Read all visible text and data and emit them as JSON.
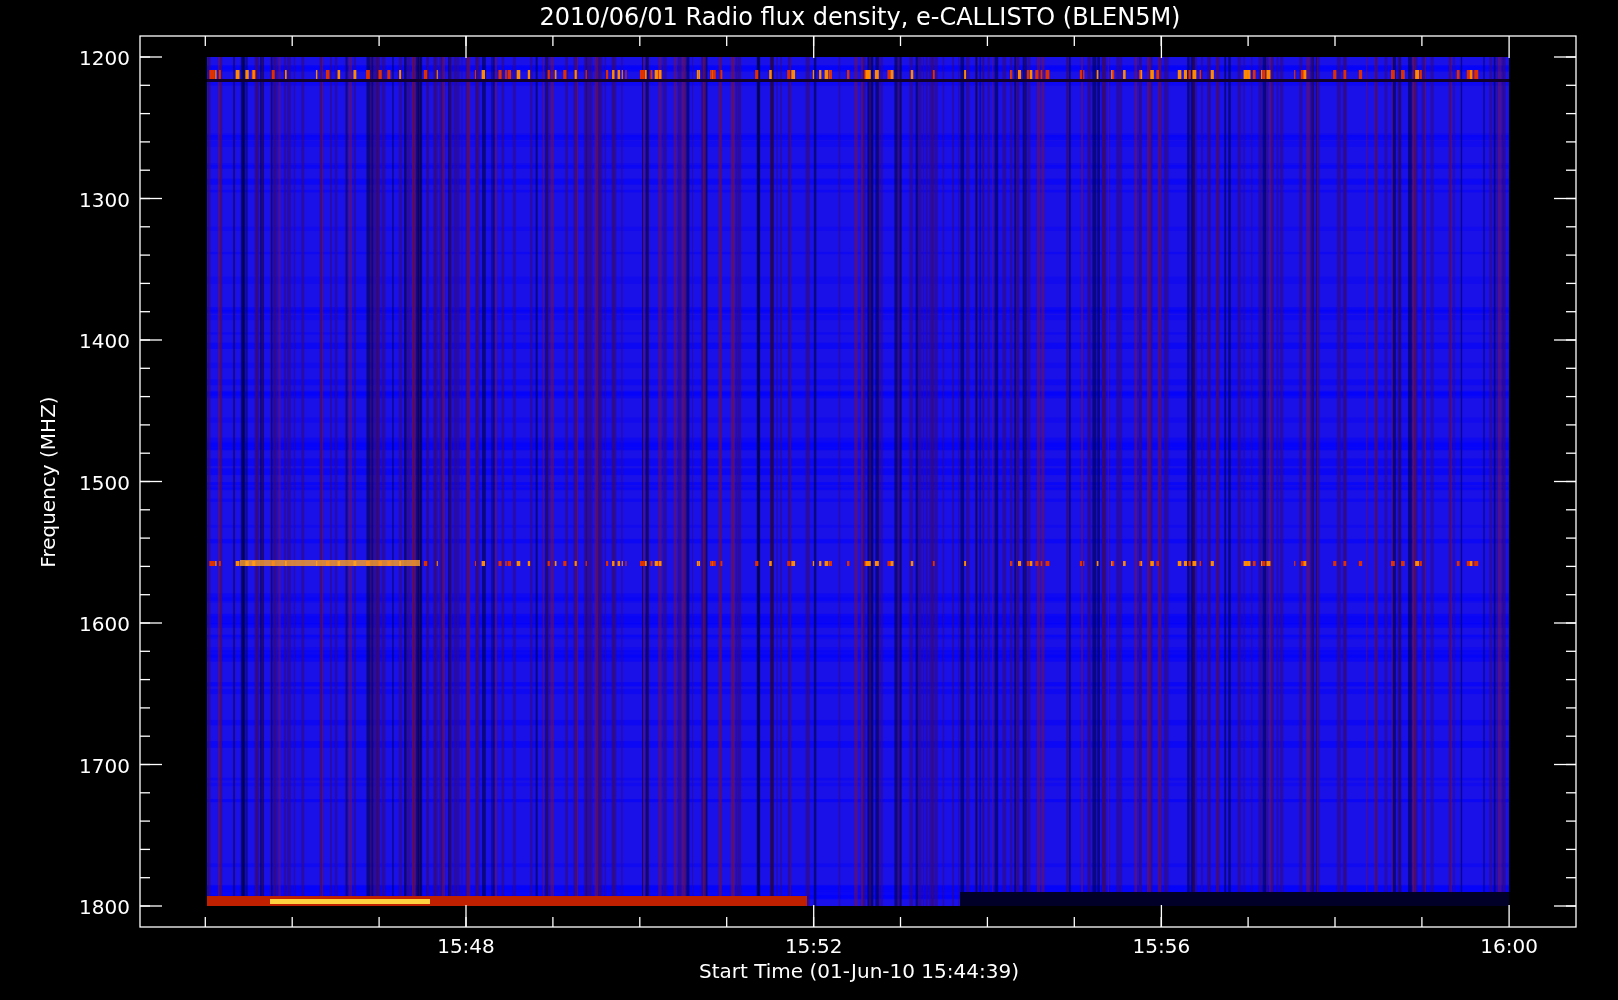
{
  "plot": {
    "title": "2010/06/01  Radio flux density, e-CALLISTO (BLEN5M)",
    "xlabel": "Start Time (01-Jun-10 15:44:39)",
    "ylabel": "Frequency (MHZ)",
    "y_tick_labels": [
      "1200",
      "1300",
      "1400",
      "1500",
      "1600",
      "1700",
      "1800"
    ],
    "x_tick_labels": [
      "15:48",
      "15:52",
      "15:56",
      "16:00"
    ]
  }
}
